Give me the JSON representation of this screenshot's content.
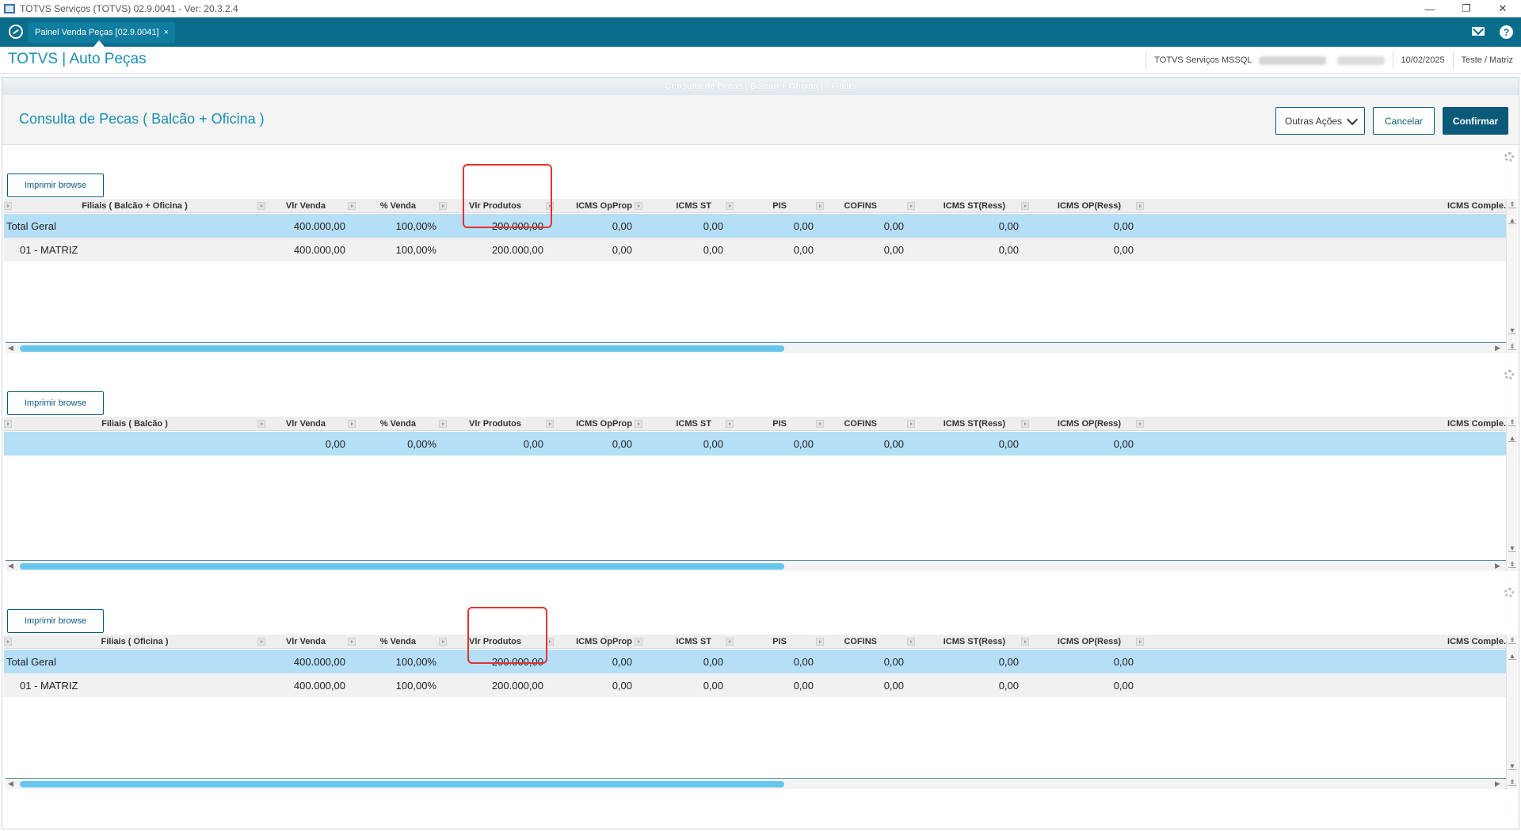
{
  "window": {
    "title": "TOTVS Serviços (TOTVS) 02.9.0041 - Ver: 20.3.2.4",
    "minimize": "—",
    "restore": "❐",
    "close": "✕"
  },
  "tabbar": {
    "tab_label": "Painel Venda Peças [02.9.0041]",
    "tab_close": "×",
    "help_glyph": "?"
  },
  "header": {
    "brand": "TOTVS | Auto Peças",
    "server_label": "TOTVS Serviços MSSQL",
    "date": "10/02/2025",
    "user_branch": "Teste / Matriz"
  },
  "dialog": {
    "title_bar": "Consulta de Pecas ( Balcão + Oficina ) - Filiais",
    "heading": "Consulta de Pecas ( Balcão + Oficina )",
    "other_actions": "Outras Ações",
    "cancel": "Cancelar",
    "confirm": "Confirmar"
  },
  "columns": [
    "Vlr Venda",
    "% Venda",
    "Vlr Produtos",
    "ICMS OpProp",
    "ICMS ST",
    "PIS",
    "COFINS",
    "ICMS ST(Ress)",
    "ICMS OP(Ress)",
    "ICMS Comple."
  ],
  "sections": [
    {
      "print_label": "Imprimir browse",
      "first_col": "Filiais ( Balcão + Oficina )",
      "rows": [
        {
          "label": "Total Geral",
          "values": [
            "400.000,00",
            "100,00%",
            "200.000,00",
            "0,00",
            "0,00",
            "0,00",
            "0,00",
            "0,00",
            "0,00"
          ]
        },
        {
          "label": "01 - MATRIZ",
          "values": [
            "400.000,00",
            "100,00%",
            "200.000,00",
            "0,00",
            "0,00",
            "0,00",
            "0,00",
            "0,00",
            "0,00"
          ]
        }
      ]
    },
    {
      "print_label": "Imprimir browse",
      "first_col": "Filiais ( Balcão )",
      "rows": [
        {
          "label": "",
          "values": [
            "0,00",
            "0,00%",
            "0,00",
            "0,00",
            "0,00",
            "0,00",
            "0,00",
            "0,00",
            "0,00"
          ]
        }
      ]
    },
    {
      "print_label": "Imprimir browse",
      "first_col": "Filiais ( Oficina )",
      "rows": [
        {
          "label": "Total Geral",
          "values": [
            "400.000,00",
            "100,00%",
            "200.000,00",
            "0,00",
            "0,00",
            "0,00",
            "0,00",
            "0,00",
            "0,00"
          ]
        },
        {
          "label": "01 - MATRIZ",
          "values": [
            "400.000,00",
            "100,00%",
            "200.000,00",
            "0,00",
            "0,00",
            "0,00",
            "0,00",
            "0,00",
            "0,00"
          ]
        }
      ]
    }
  ],
  "colors": {
    "teal": "#0b6d8c",
    "brand_blue": "#1a8fb3",
    "selected_row": "#b5def7",
    "highlight": "#e3322f"
  }
}
